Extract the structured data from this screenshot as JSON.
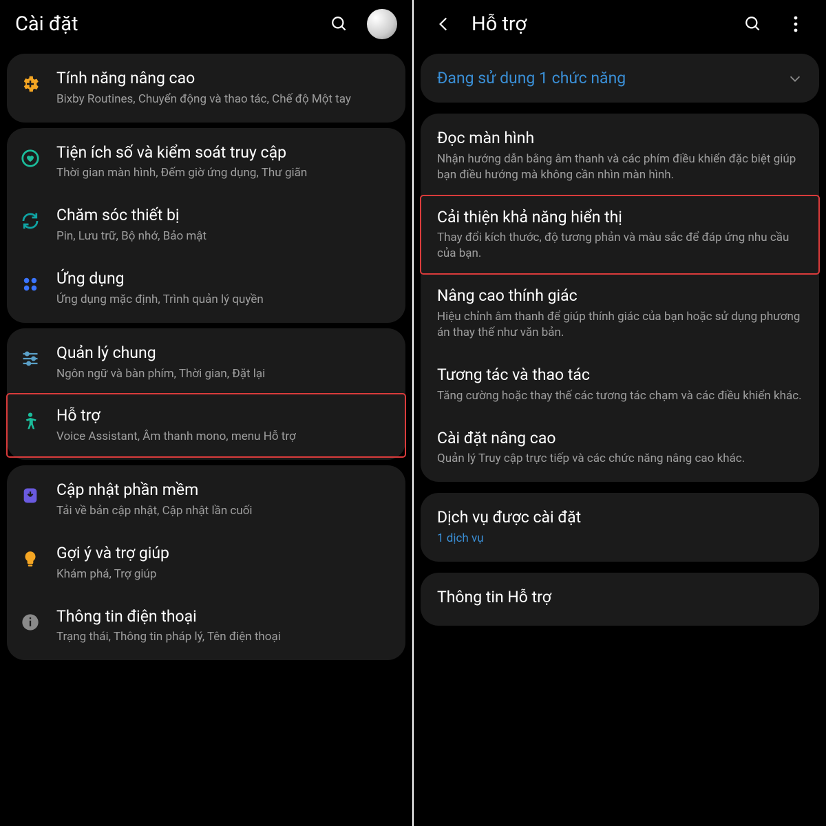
{
  "left": {
    "title": "Cài đặt",
    "groups": [
      {
        "items": [
          {
            "icon": "gear-plus",
            "iconColor": "#f5a623",
            "title": "Tính năng nâng cao",
            "sub": "Bixby Routines, Chuyển động và thao tác, Chế độ Một tay"
          }
        ]
      },
      {
        "items": [
          {
            "icon": "ring-heart",
            "iconColor": "#1bbc9b",
            "title": "Tiện ích số và kiểm soát truy cập",
            "sub": "Thời gian màn hình, Đếm giờ ứng dụng, Thư giãn"
          },
          {
            "icon": "ring-refresh",
            "iconColor": "#0fa3a3",
            "title": "Chăm sóc thiết bị",
            "sub": "Pin, Lưu trữ, Bộ nhớ, Bảo mật"
          },
          {
            "icon": "grid4",
            "iconColor": "#3a74ff",
            "title": "Ứng dụng",
            "sub": "Ứng dụng mặc định, Trình quản lý quyền"
          }
        ]
      },
      {
        "items": [
          {
            "icon": "sliders",
            "iconColor": "#5aa0c8",
            "title": "Quản lý chung",
            "sub": "Ngôn ngữ và bàn phím, Thời gian, Đặt lại"
          },
          {
            "icon": "person",
            "iconColor": "#1bbc9b",
            "title": "Hỗ trợ",
            "sub": "Voice Assistant, Âm thanh mono, menu Hỗ trợ",
            "highlight": true
          }
        ]
      },
      {
        "items": [
          {
            "icon": "update",
            "iconColor": "#6a5ae0",
            "title": "Cập nhật phần mềm",
            "sub": "Tải về bản cập nhật, Cập nhật lần cuối"
          },
          {
            "icon": "bulb",
            "iconColor": "#f5a623",
            "title": "Gợi ý và trợ giúp",
            "sub": "Khám phá, Trợ giúp"
          },
          {
            "icon": "info",
            "iconColor": "#8a8a8a",
            "title": "Thông tin điện thoại",
            "sub": "Trạng thái, Thông tin pháp lý, Tên điện thoại"
          }
        ]
      }
    ]
  },
  "right": {
    "title": "Hỗ trợ",
    "banner": "Đang sử dụng 1 chức năng",
    "group": [
      {
        "title": "Đọc màn hình",
        "sub": "Nhận hướng dẫn bằng âm thanh và các phím điều khiển đặc biệt giúp bạn điều hướng mà không cần nhìn màn hình."
      },
      {
        "title": "Cải thiện khả năng hiển thị",
        "sub": "Thay đổi kích thước, độ tương phản và màu sắc để đáp ứng nhu cầu của bạn.",
        "highlight": true
      },
      {
        "title": "Nâng cao thính giác",
        "sub": "Hiệu chỉnh âm thanh để giúp thính giác của bạn hoặc sử dụng phương án thay thế như văn bản."
      },
      {
        "title": "Tương tác và thao tác",
        "sub": "Tăng cường hoặc thay thế các tương tác chạm và các điều khiển khác."
      },
      {
        "title": "Cài đặt nâng cao",
        "sub": "Quản lý Truy cập trực tiếp và các chức năng nâng cao khác."
      }
    ],
    "installed": {
      "title": "Dịch vụ được cài đặt",
      "sub": "1 dịch vụ"
    },
    "about": {
      "title": "Thông tin Hỗ trợ"
    }
  }
}
